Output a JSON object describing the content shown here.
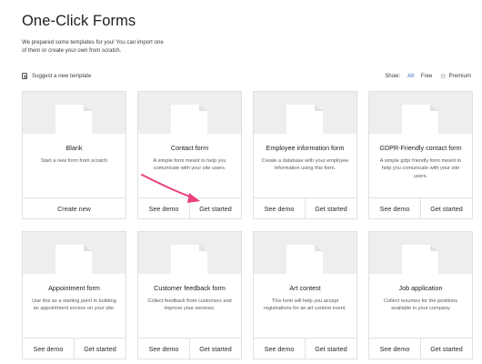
{
  "header": {
    "title": "One-Click Forms",
    "intro": "We prepared some templates for you! You can import one of them or create your own from scratch."
  },
  "suggest": {
    "label": "Suggest a new template",
    "icon": "document-icon"
  },
  "filters": {
    "label": "Show:",
    "options": [
      "All",
      "Free",
      "Premium"
    ],
    "active": "All",
    "premium_icon": "star-icon"
  },
  "colors": {
    "accent": "#3467c7",
    "arrow": "#e8417f"
  },
  "templates": [
    {
      "title": "Blank",
      "description": "Start a new form from scratch",
      "actions": [
        "Create new"
      ]
    },
    {
      "title": "Contact form",
      "description": "A simple form meant to help you comunicate with your site users.",
      "actions": [
        "See demo",
        "Get started"
      ]
    },
    {
      "title": "Employee information form",
      "description": "Create a database with your employee information using this form.",
      "actions": [
        "See demo",
        "Get started"
      ]
    },
    {
      "title": "GDPR-Friendly contact form",
      "description": "A simple gdpr friendly form meant to help you comunicate with your site users.",
      "actions": [
        "See demo",
        "Get started"
      ]
    },
    {
      "title": "Appointment form",
      "description": "Use this as a starting point in building an appointment service on your site.",
      "actions": [
        "See demo",
        "Get started"
      ]
    },
    {
      "title": "Customer feedback form",
      "description": "Collect feedback from customers and improve your services.",
      "actions": [
        "See demo",
        "Get started"
      ]
    },
    {
      "title": "Art contest",
      "description": "This form will help you accept registrations for an art contest event.",
      "actions": [
        "See demo",
        "Get started"
      ]
    },
    {
      "title": "Job application",
      "description": "Collect resumes for the positions available in your company",
      "actions": [
        "See demo",
        "Get started"
      ]
    }
  ]
}
